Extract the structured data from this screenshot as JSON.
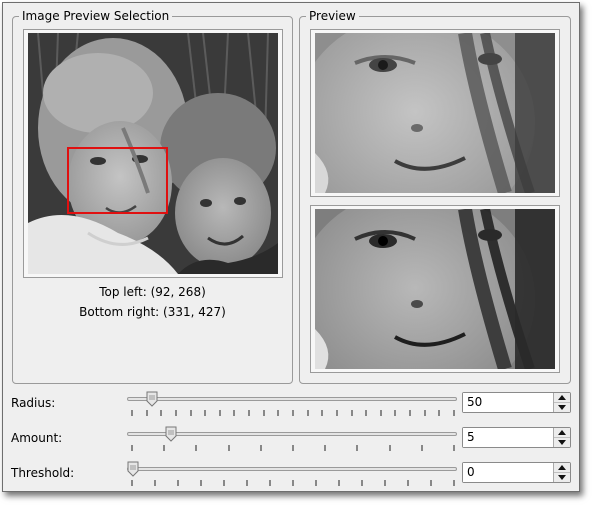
{
  "selection_panel": {
    "title": "Image Preview Selection",
    "top_left_text": "Top left: (92, 268)",
    "bottom_right_text": "Bottom right: (331, 427)"
  },
  "preview_panel": {
    "title": "Preview"
  },
  "controls": {
    "radius": {
      "label": "Radius:",
      "value": "50",
      "level": 0.06
    },
    "amount": {
      "label": "Amount:",
      "value": "5",
      "level": 0.12
    },
    "threshold": {
      "label": "Threshold:",
      "value": "0",
      "level": 0.0
    }
  },
  "colors": {
    "selection_rect": "#e01010",
    "window_bg": "#efefef"
  },
  "icons": {
    "spin_up": "arrow-up-icon",
    "spin_down": "arrow-down-icon",
    "slider_handle": "slider-handle-icon"
  }
}
